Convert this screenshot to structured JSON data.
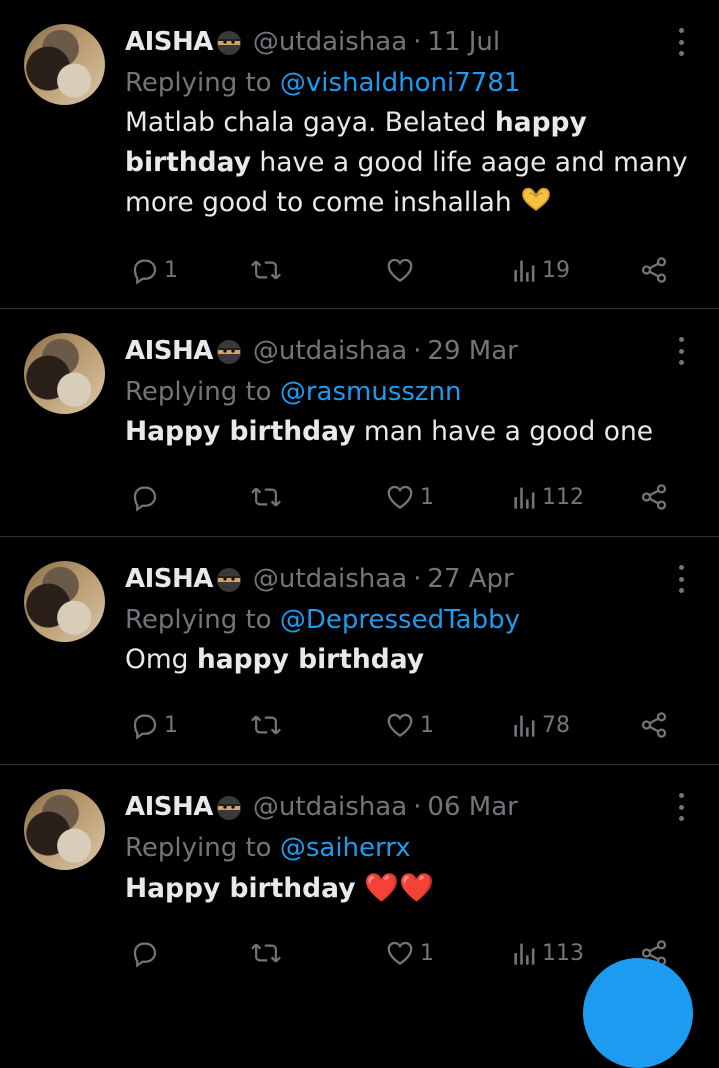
{
  "tweets": [
    {
      "name": "AISHA",
      "handle": "@utdaishaa",
      "date": "11 Jul",
      "replying_prefix": "Replying to",
      "replying_to": "@vishaldhoni7781",
      "text_parts": [
        {
          "t": "Matlab chala gaya.  Belated ",
          "b": false
        },
        {
          "t": "happy birthday",
          "b": true
        },
        {
          "t": " have a good life aage and many more good to come inshallah ",
          "b": false
        }
      ],
      "emoji": "heart-hands-emoji",
      "replies": "1",
      "retweets": "",
      "likes": "",
      "views": "19"
    },
    {
      "name": "AISHA",
      "handle": "@utdaishaa",
      "date": "29 Mar",
      "replying_prefix": "Replying to",
      "replying_to": "@rasmussznn",
      "text_parts": [
        {
          "t": "Happy birthday",
          "b": true
        },
        {
          "t": " man have a good one",
          "b": false
        }
      ],
      "replies": "",
      "retweets": "",
      "likes": "1",
      "views": "112"
    },
    {
      "name": "AISHA",
      "handle": "@utdaishaa",
      "date": "27 Apr",
      "replying_prefix": "Replying to",
      "replying_to": "@DepressedTabby",
      "text_parts": [
        {
          "t": "Omg ",
          "b": false
        },
        {
          "t": "happy birthday",
          "b": true
        }
      ],
      "replies": "1",
      "retweets": "",
      "likes": "1",
      "views": "78"
    },
    {
      "name": "AISHA",
      "handle": "@utdaishaa",
      "date": "06 Mar",
      "replying_prefix": "Replying to",
      "replying_to": "@saiherrx",
      "text_parts": [
        {
          "t": "Happy birthday",
          "b": true
        },
        {
          "t": " ❤️❤️",
          "b": false
        }
      ],
      "replies": "",
      "retweets": "",
      "likes": "1",
      "views": "113"
    }
  ],
  "colors": {
    "background": "#000000",
    "text": "#e7e9ea",
    "muted": "#71767b",
    "accent": "#1d9bf0",
    "divider": "#2f3336"
  },
  "icons": [
    "ninja-emoji",
    "more-icon",
    "reply-icon",
    "retweet-icon",
    "like-icon",
    "views-icon",
    "share-icon",
    "compose-fab"
  ]
}
